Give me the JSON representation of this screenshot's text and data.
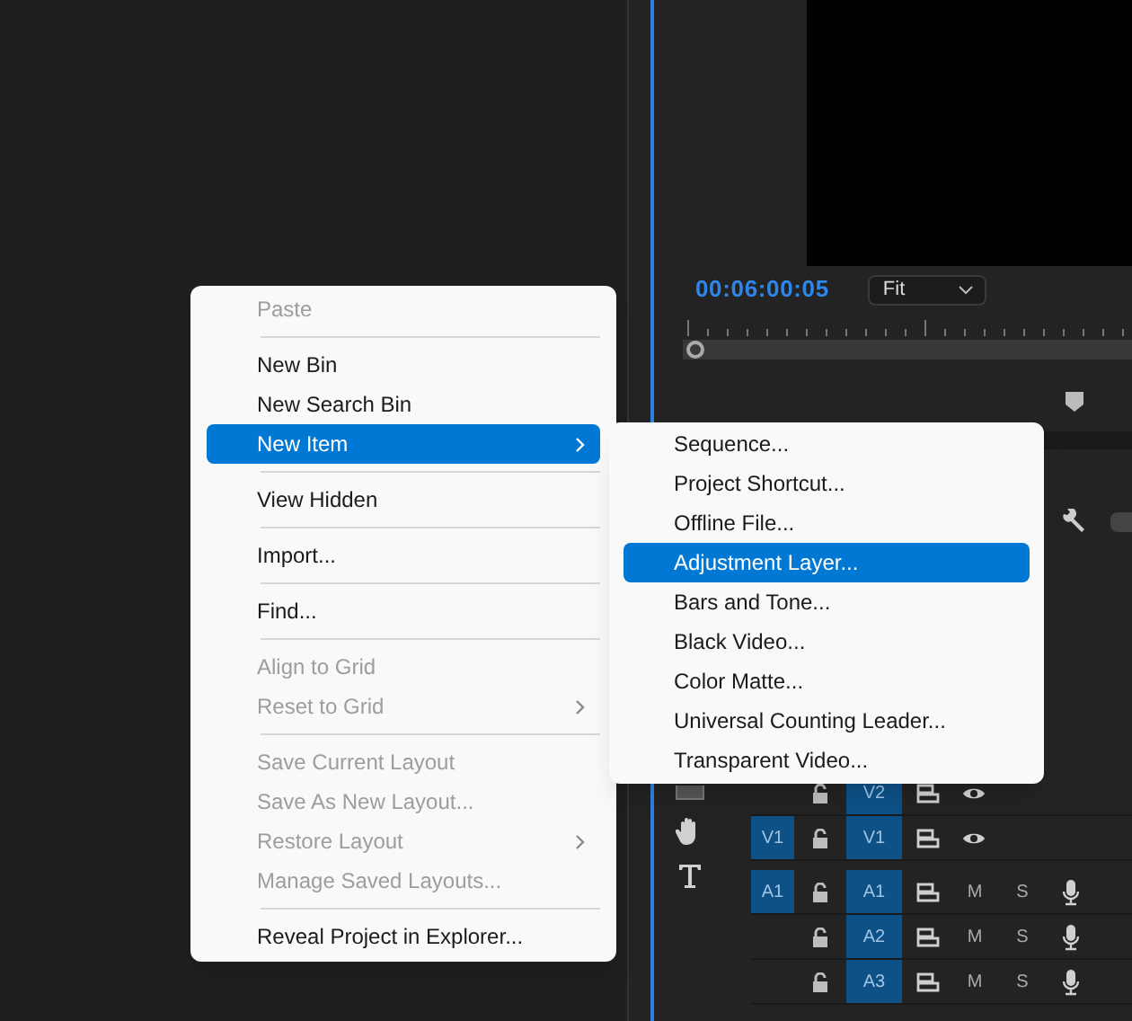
{
  "monitor": {
    "timecode": "00:06:00:05",
    "zoom": "Fit"
  },
  "timeline": {
    "tracks": [
      {
        "kind": "video",
        "target": "V2"
      },
      {
        "kind": "video",
        "source": "V1",
        "target": "V1"
      },
      {
        "kind": "audio",
        "source": "A1",
        "target": "A1",
        "mute": "M",
        "solo": "S"
      },
      {
        "kind": "audio",
        "target": "A2",
        "mute": "M",
        "solo": "S"
      },
      {
        "kind": "audio",
        "target": "A3",
        "mute": "M",
        "solo": "S"
      }
    ]
  },
  "context_menu": {
    "items": [
      {
        "kind": "item",
        "label": "Paste",
        "disabled": true,
        "selected": false,
        "submenu": false
      },
      {
        "kind": "separator"
      },
      {
        "kind": "item",
        "label": "New Bin",
        "disabled": false,
        "selected": false,
        "submenu": false
      },
      {
        "kind": "item",
        "label": "New Search Bin",
        "disabled": false,
        "selected": false,
        "submenu": false
      },
      {
        "kind": "item",
        "label": "New Item",
        "disabled": false,
        "selected": true,
        "submenu": true
      },
      {
        "kind": "separator"
      },
      {
        "kind": "item",
        "label": "View Hidden",
        "disabled": false,
        "selected": false,
        "submenu": false
      },
      {
        "kind": "separator"
      },
      {
        "kind": "item",
        "label": "Import...",
        "disabled": false,
        "selected": false,
        "submenu": false
      },
      {
        "kind": "separator"
      },
      {
        "kind": "item",
        "label": "Find...",
        "disabled": false,
        "selected": false,
        "submenu": false
      },
      {
        "kind": "separator"
      },
      {
        "kind": "item",
        "label": "Align to Grid",
        "disabled": true,
        "selected": false,
        "submenu": false
      },
      {
        "kind": "item",
        "label": "Reset to Grid",
        "disabled": true,
        "selected": false,
        "submenu": true
      },
      {
        "kind": "separator"
      },
      {
        "kind": "item",
        "label": "Save Current Layout",
        "disabled": true,
        "selected": false,
        "submenu": false
      },
      {
        "kind": "item",
        "label": "Save As New Layout...",
        "disabled": true,
        "selected": false,
        "submenu": false
      },
      {
        "kind": "item",
        "label": "Restore Layout",
        "disabled": true,
        "selected": false,
        "submenu": true
      },
      {
        "kind": "item",
        "label": "Manage Saved Layouts...",
        "disabled": true,
        "selected": false,
        "submenu": false
      },
      {
        "kind": "separator"
      },
      {
        "kind": "item",
        "label": "Reveal Project in Explorer...",
        "disabled": false,
        "selected": false,
        "submenu": false
      }
    ]
  },
  "submenu": {
    "items": [
      {
        "label": "Sequence...",
        "selected": false
      },
      {
        "label": "Project Shortcut...",
        "selected": false
      },
      {
        "label": "Offline File...",
        "selected": false
      },
      {
        "label": "Adjustment Layer...",
        "selected": true
      },
      {
        "label": "Bars and Tone...",
        "selected": false
      },
      {
        "label": "Black Video...",
        "selected": false
      },
      {
        "label": "Color Matte...",
        "selected": false
      },
      {
        "label": "Universal Counting Leader...",
        "selected": false
      },
      {
        "label": "Transparent Video...",
        "selected": false
      }
    ]
  }
}
